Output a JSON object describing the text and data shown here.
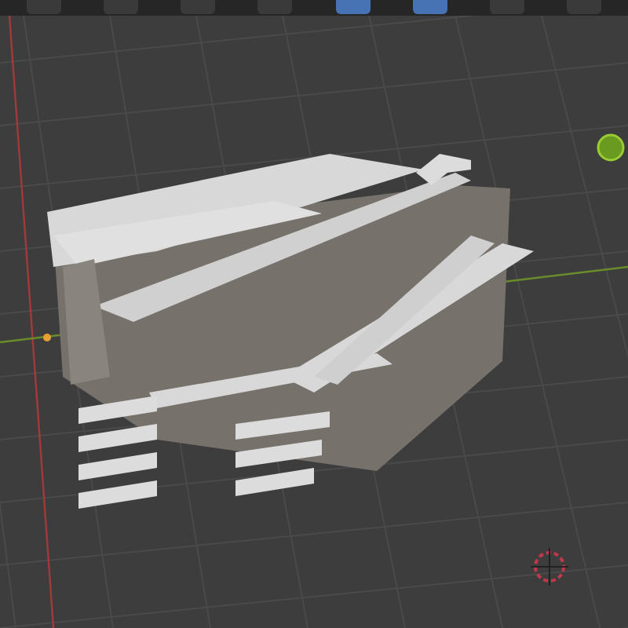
{
  "header_toolbar": [
    {
      "selected": false
    },
    {
      "selected": false
    },
    {
      "selected": false
    },
    {
      "selected": false
    },
    {
      "selected": true
    },
    {
      "selected": true
    },
    {
      "selected": false
    },
    {
      "selected": false
    }
  ]
}
